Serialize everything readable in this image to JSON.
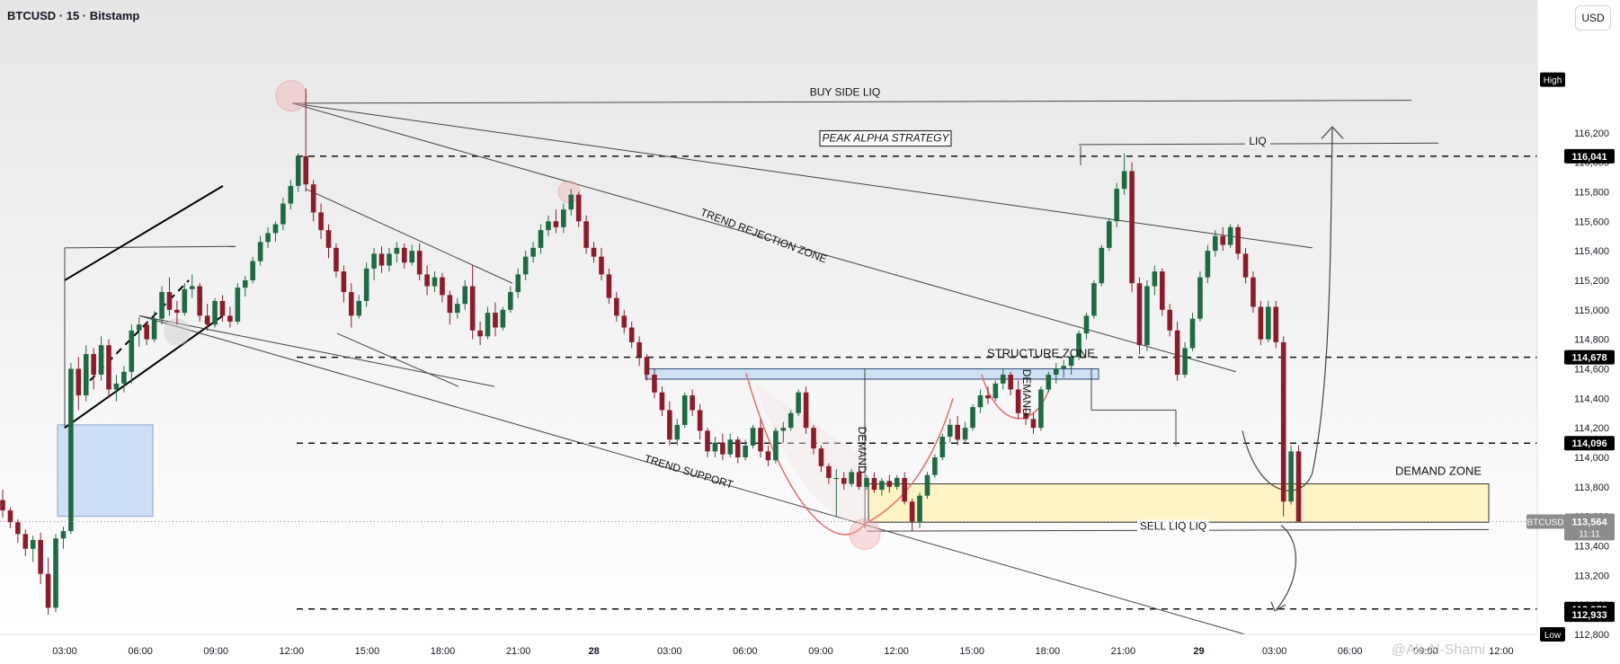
{
  "header": {
    "title": "BTCUSD · 15 · Bitstamp",
    "currency_button": "USD"
  },
  "watermark": "@Ali-Al-Shami",
  "chart_data": {
    "type": "candlestick",
    "symbol": "BTCUSD",
    "timeframe": "15",
    "exchange": "Bitstamp",
    "ylim": [
      112800,
      117100
    ],
    "y_ticks": [
      112800,
      113000,
      113200,
      113400,
      113600,
      113800,
      114000,
      114200,
      114400,
      114600,
      114800,
      115000,
      115200,
      115400,
      115600,
      115800,
      116000,
      116200
    ],
    "x_ticks": [
      "03:00",
      "06:00",
      "09:00",
      "12:00",
      "15:00",
      "18:00",
      "21:00",
      "28",
      "03:00",
      "06:00",
      "09:00",
      "12:00",
      "15:00",
      "18:00",
      "21:00",
      "29",
      "03:00",
      "06:00",
      "09:00",
      "12:00"
    ],
    "last_price": {
      "label": "BTCUSD",
      "price": "113,564",
      "countdown": "11:11",
      "value": 113564
    },
    "price_levels": [
      {
        "value": 116041,
        "label": "116,041",
        "style": "dashed"
      },
      {
        "value": 114678,
        "label": "114,678",
        "style": "dashed"
      },
      {
        "value": 114096,
        "label": "114,096",
        "style": "dashed"
      },
      {
        "value": 112972,
        "label": "112,972",
        "style": "dashed"
      },
      {
        "value": 112933,
        "label": "112,933",
        "style": "marker"
      }
    ],
    "high_label": "High",
    "low_label": "Low",
    "annotations": [
      {
        "text": "BUY SIDE LIQ"
      },
      {
        "text": "PEAK ALPHA STRATEGY",
        "boxed": true
      },
      {
        "text": "LIQ"
      },
      {
        "text": "TREND REJECTION ZONE"
      },
      {
        "text": "STRUCTURE ZONE"
      },
      {
        "text": "DEMAND"
      },
      {
        "text": "DEMAND"
      },
      {
        "text": "TREND SUPPORT"
      },
      {
        "text": "DEMAND ZONE"
      },
      {
        "text": "SELL LIQ LIQ"
      }
    ],
    "colors": {
      "up": "#1e6b43",
      "down": "#8c1c2c",
      "demand_zone": "#fdf3c4",
      "structure_zone": "#cfe0f5",
      "blue_box": "#c9dcf5"
    },
    "candles": [
      [
        113710,
        113780,
        113590,
        113640
      ],
      [
        113640,
        113660,
        113520,
        113560
      ],
      [
        113560,
        113580,
        113420,
        113480
      ],
      [
        113480,
        113510,
        113330,
        113380
      ],
      [
        113380,
        113470,
        113290,
        113440
      ],
      [
        113440,
        113490,
        113140,
        113210
      ],
      [
        113210,
        113320,
        112933,
        112980
      ],
      [
        112980,
        113480,
        112950,
        113450
      ],
      [
        113450,
        113530,
        113380,
        113500
      ],
      [
        113500,
        114640,
        113480,
        114600
      ],
      [
        114600,
        114680,
        114320,
        114420
      ],
      [
        114420,
        114760,
        114380,
        114700
      ],
      [
        114700,
        114740,
        114460,
        114560
      ],
      [
        114560,
        114820,
        114520,
        114760
      ],
      [
        114760,
        114800,
        114400,
        114460
      ],
      [
        114460,
        114560,
        114380,
        114500
      ],
      [
        114500,
        114620,
        114440,
        114580
      ],
      [
        114580,
        114900,
        114500,
        114860
      ],
      [
        114860,
        114950,
        114750,
        114900
      ],
      [
        114900,
        114920,
        114760,
        114800
      ],
      [
        114800,
        114990,
        114780,
        114940
      ],
      [
        114940,
        115160,
        114900,
        115120
      ],
      [
        115120,
        115220,
        114960,
        115000
      ],
      [
        115000,
        115060,
        114900,
        114980
      ],
      [
        114980,
        115180,
        114960,
        115140
      ],
      [
        115140,
        115240,
        115080,
        115160
      ],
      [
        115160,
        115180,
        114920,
        114960
      ],
      [
        114960,
        115040,
        114860,
        114900
      ],
      [
        114900,
        115080,
        114880,
        115060
      ],
      [
        115060,
        115100,
        114920,
        114960
      ],
      [
        114960,
        115020,
        114880,
        114920
      ],
      [
        114920,
        115180,
        114900,
        115150
      ],
      [
        115150,
        115230,
        115090,
        115200
      ],
      [
        115200,
        115360,
        115180,
        115330
      ],
      [
        115330,
        115500,
        115300,
        115460
      ],
      [
        115460,
        115560,
        115420,
        115520
      ],
      [
        115520,
        115600,
        115460,
        115580
      ],
      [
        115580,
        115760,
        115540,
        115720
      ],
      [
        115720,
        115880,
        115680,
        115840
      ],
      [
        115840,
        116060,
        115800,
        116041
      ],
      [
        116041,
        116500,
        115800,
        115850
      ],
      [
        115850,
        115880,
        115600,
        115660
      ],
      [
        115660,
        115720,
        115480,
        115540
      ],
      [
        115540,
        115580,
        115350,
        115420
      ],
      [
        115420,
        115450,
        115220,
        115260
      ],
      [
        115260,
        115300,
        115050,
        115120
      ],
      [
        115120,
        115180,
        114880,
        114960
      ],
      [
        114960,
        115100,
        114940,
        115060
      ],
      [
        115060,
        115320,
        115020,
        115280
      ],
      [
        115280,
        115420,
        115200,
        115380
      ],
      [
        115380,
        115430,
        115250,
        115300
      ],
      [
        115300,
        115420,
        115260,
        115380
      ],
      [
        115380,
        115460,
        115320,
        115420
      ],
      [
        115420,
        115450,
        115280,
        115320
      ],
      [
        115320,
        115440,
        115300,
        115400
      ],
      [
        115400,
        115450,
        115200,
        115240
      ],
      [
        115240,
        115300,
        115100,
        115160
      ],
      [
        115160,
        115260,
        115120,
        115220
      ],
      [
        115220,
        115250,
        115050,
        115100
      ],
      [
        115100,
        115130,
        114900,
        114980
      ],
      [
        114980,
        115080,
        114940,
        115040
      ],
      [
        115040,
        115200,
        115000,
        115160
      ],
      [
        115160,
        115300,
        114800,
        114860
      ],
      [
        114860,
        114920,
        114760,
        114820
      ],
      [
        114820,
        115020,
        114800,
        114980
      ],
      [
        114980,
        115050,
        114820,
        114880
      ],
      [
        114880,
        115020,
        114860,
        115000
      ],
      [
        115000,
        115160,
        114980,
        115120
      ],
      [
        115120,
        115280,
        115080,
        115240
      ],
      [
        115240,
        115400,
        115200,
        115360
      ],
      [
        115360,
        115460,
        115320,
        115420
      ],
      [
        115420,
        115580,
        115380,
        115540
      ],
      [
        115540,
        115640,
        115500,
        115600
      ],
      [
        115600,
        115680,
        115520,
        115560
      ],
      [
        115560,
        115720,
        115520,
        115680
      ],
      [
        115680,
        115820,
        115640,
        115780
      ],
      [
        115780,
        115800,
        115560,
        115600
      ],
      [
        115600,
        115640,
        115380,
        115420
      ],
      [
        115420,
        115460,
        115320,
        115360
      ],
      [
        115360,
        115420,
        115200,
        115240
      ],
      [
        115240,
        115280,
        115040,
        115080
      ],
      [
        115080,
        115120,
        114920,
        114960
      ],
      [
        114960,
        115000,
        114840,
        114880
      ],
      [
        114880,
        114920,
        114740,
        114780
      ],
      [
        114780,
        114820,
        114620,
        114680
      ],
      [
        114680,
        114700,
        114520,
        114560
      ],
      [
        114560,
        114600,
        114400,
        114440
      ],
      [
        114440,
        114480,
        114280,
        114320
      ],
      [
        114320,
        114380,
        114080,
        114120
      ],
      [
        114120,
        114260,
        114080,
        114220
      ],
      [
        114220,
        114440,
        114200,
        114420
      ],
      [
        114420,
        114460,
        114280,
        114320
      ],
      [
        114320,
        114360,
        114120,
        114180
      ],
      [
        114180,
        114200,
        114000,
        114040
      ],
      [
        114040,
        114140,
        114000,
        114100
      ],
      [
        114100,
        114160,
        113980,
        114020
      ],
      [
        114020,
        114160,
        114000,
        114120
      ],
      [
        114120,
        114140,
        113960,
        114000
      ],
      [
        114000,
        114120,
        113980,
        114080
      ],
      [
        114080,
        114220,
        114060,
        114200
      ],
      [
        114200,
        114260,
        114000,
        114040
      ],
      [
        114040,
        114080,
        113940,
        113980
      ],
      [
        113980,
        114200,
        113960,
        114180
      ],
      [
        114180,
        114240,
        114100,
        114200
      ],
      [
        114200,
        114320,
        114180,
        114300
      ],
      [
        114300,
        114460,
        114280,
        114440
      ],
      [
        114440,
        114480,
        114160,
        114200
      ],
      [
        114200,
        114220,
        114020,
        114060
      ],
      [
        114060,
        114080,
        113900,
        113940
      ],
      [
        113940,
        113960,
        113820,
        113860
      ],
      [
        113860,
        113920,
        113600,
        113860
      ],
      [
        113860,
        113900,
        113780,
        113820
      ],
      [
        113820,
        113920,
        113800,
        113900
      ],
      [
        113900,
        113940,
        113780,
        113800
      ],
      [
        113800,
        113880,
        113780,
        113860
      ],
      [
        113860,
        113900,
        113760,
        113780
      ],
      [
        113780,
        113860,
        113740,
        113840
      ],
      [
        113840,
        113880,
        113760,
        113800
      ],
      [
        113800,
        113880,
        113780,
        113860
      ],
      [
        113860,
        113900,
        113680,
        113700
      ],
      [
        113700,
        113720,
        113500,
        113560
      ],
      [
        113560,
        113760,
        113520,
        113740
      ],
      [
        113740,
        113900,
        113720,
        113880
      ],
      [
        113880,
        114020,
        113860,
        114000
      ],
      [
        114000,
        114160,
        113980,
        114140
      ],
      [
        114140,
        114260,
        114100,
        114220
      ],
      [
        114220,
        114280,
        114080,
        114120
      ],
      [
        114120,
        114240,
        114100,
        114200
      ],
      [
        114200,
        114360,
        114180,
        114340
      ],
      [
        114340,
        114460,
        114300,
        114420
      ],
      [
        114420,
        114480,
        114360,
        114400
      ],
      [
        114400,
        114520,
        114380,
        114500
      ],
      [
        114500,
        114600,
        114460,
        114560
      ],
      [
        114560,
        114580,
        114420,
        114460
      ],
      [
        114460,
        114520,
        114260,
        114300
      ],
      [
        114300,
        114340,
        114220,
        114260
      ],
      [
        114260,
        114300,
        114160,
        114200
      ],
      [
        114200,
        114480,
        114180,
        114460
      ],
      [
        114460,
        114580,
        114440,
        114560
      ],
      [
        114560,
        114640,
        114500,
        114600
      ],
      [
        114600,
        114660,
        114540,
        114620
      ],
      [
        114620,
        114700,
        114560,
        114680
      ],
      [
        114680,
        114860,
        114660,
        114840
      ],
      [
        114840,
        114980,
        114800,
        114960
      ],
      [
        114960,
        115200,
        114940,
        115180
      ],
      [
        115180,
        115440,
        115160,
        115420
      ],
      [
        115420,
        115620,
        115400,
        115600
      ],
      [
        115600,
        115860,
        115560,
        115820
      ],
      [
        115820,
        116060,
        115780,
        115940
      ],
      [
        115940,
        116000,
        115120,
        115180
      ],
      [
        115180,
        115220,
        114700,
        114760
      ],
      [
        114760,
        115200,
        114720,
        115160
      ],
      [
        115160,
        115300,
        115100,
        115260
      ],
      [
        115260,
        115280,
        114960,
        115000
      ],
      [
        115000,
        115040,
        114820,
        114860
      ],
      [
        114860,
        114920,
        114520,
        114560
      ],
      [
        114560,
        114780,
        114540,
        114740
      ],
      [
        114740,
        114980,
        114720,
        114940
      ],
      [
        114940,
        115260,
        114920,
        115220
      ],
      [
        115220,
        115440,
        115180,
        115400
      ],
      [
        115400,
        115540,
        115360,
        115500
      ],
      [
        115500,
        115560,
        115400,
        115440
      ],
      [
        115440,
        115580,
        115420,
        115560
      ],
      [
        115560,
        115580,
        115340,
        115380
      ],
      [
        115380,
        115420,
        115180,
        115220
      ],
      [
        115220,
        115260,
        114980,
        115020
      ],
      [
        115020,
        115060,
        114760,
        114800
      ],
      [
        114800,
        115060,
        114780,
        115020
      ],
      [
        115020,
        115060,
        114740,
        114780
      ],
      [
        114780,
        114820,
        113600,
        113700
      ],
      [
        113700,
        114080,
        113680,
        114040
      ],
      [
        114040,
        114080,
        113560,
        113564
      ]
    ]
  }
}
